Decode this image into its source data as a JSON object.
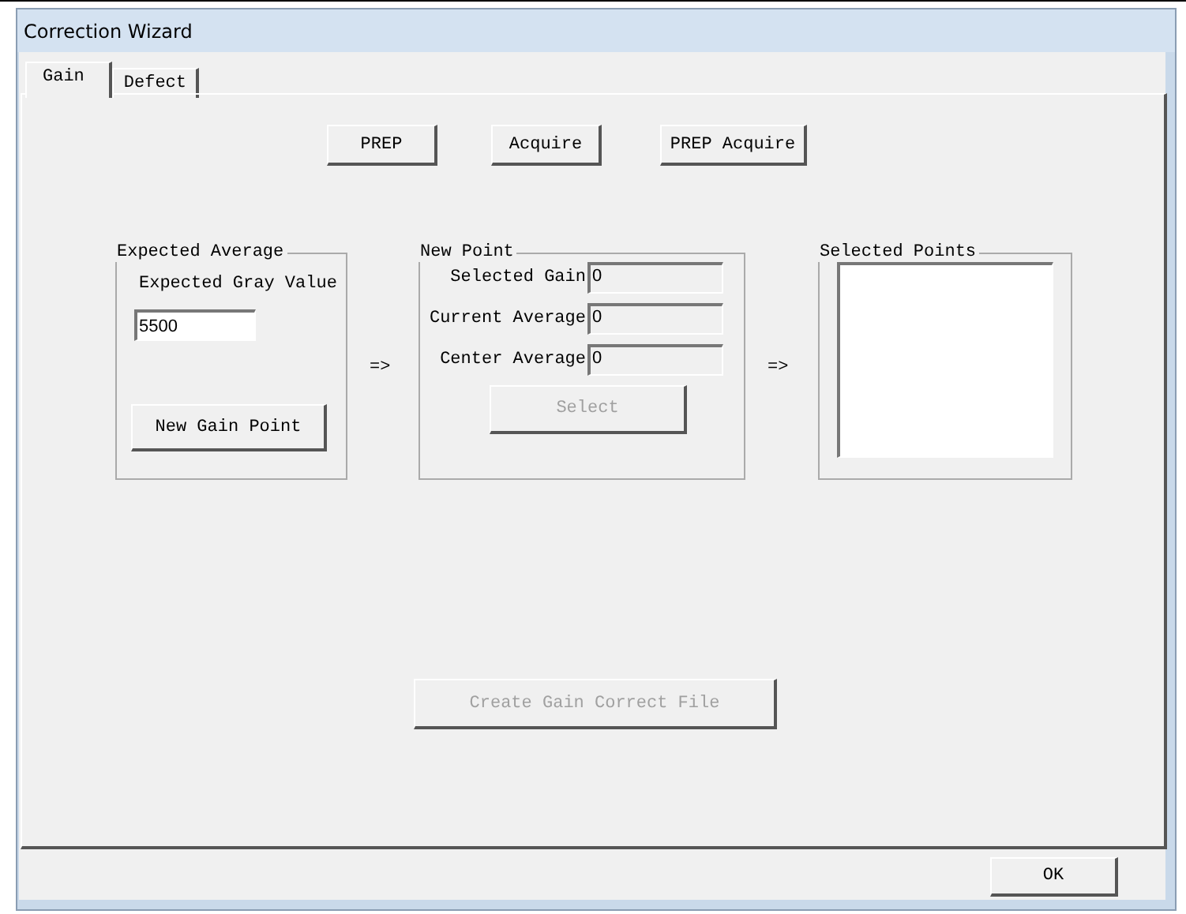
{
  "window": {
    "title": "Correction Wizard"
  },
  "tabs": [
    {
      "label": "Gain",
      "selected": true
    },
    {
      "label": "Defect",
      "selected": false
    }
  ],
  "top_buttons": [
    {
      "label": "PREP",
      "disabled": false
    },
    {
      "label": "Acquire",
      "disabled": false
    },
    {
      "label": "PREP Acquire",
      "disabled": false
    }
  ],
  "expected_average": {
    "title": "Expected Average",
    "label": "Expected Gray Value",
    "value": "5500",
    "button": {
      "label": "New Gain Point",
      "disabled": false
    }
  },
  "arrows": [
    "=>",
    "=>"
  ],
  "new_point": {
    "title": "New Point",
    "fields": [
      {
        "label": "Selected Gain",
        "value": "0"
      },
      {
        "label": "Current Average",
        "value": "0"
      },
      {
        "label": "Center Average",
        "value": "0"
      }
    ],
    "button": {
      "label": "Select",
      "disabled": true
    }
  },
  "selected_points": {
    "title": "Selected Points"
  },
  "create_button": {
    "label": "Create Gain Correct File",
    "disabled": true
  },
  "ok_button": {
    "label": "OK",
    "disabled": false
  }
}
